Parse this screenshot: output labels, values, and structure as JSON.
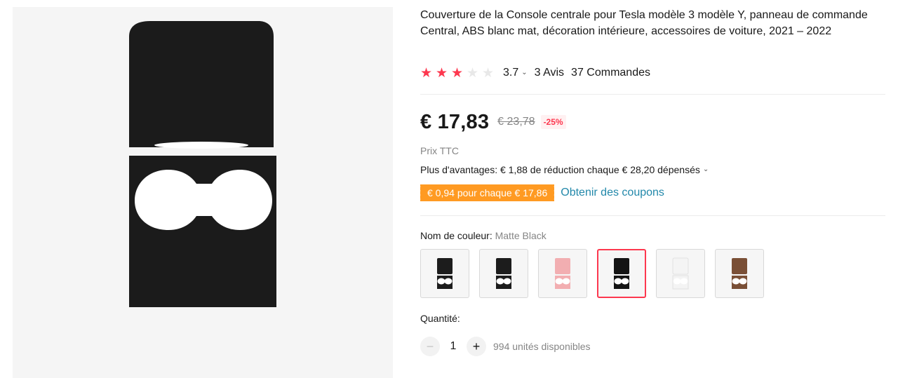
{
  "product": {
    "title": "Couverture de la Console centrale pour Tesla modèle 3 modèle Y, panneau de commande Central, ABS blanc mat, décoration intérieure, accessoires de voiture, 2021 – 2022",
    "image_alt": "Matte Black console cover"
  },
  "rating": {
    "value": "3.7",
    "stars": 3.7,
    "star_count": 5,
    "reviews": "3 Avis",
    "orders": "37 Commandes",
    "star_color": "#fd384f"
  },
  "pricing": {
    "price": "€ 17,83",
    "original_price": "€ 23,78",
    "discount": "-25%",
    "tax_note": "Prix TTC",
    "perks": "Plus d'avantages: € 1,88 de réduction chaque € 28,20 dépensés",
    "coupon": "€ 0,94 pour chaque € 17,86",
    "coupon_link": "Obtenir des coupons",
    "coupon_color": "#ff9a22"
  },
  "color": {
    "label": "Nom de couleur:",
    "selected": "Matte Black",
    "selected_border": "#fd384f",
    "swatches": [
      {
        "name": "swatch-black-1",
        "fill": "#1c1c1c",
        "selected": false
      },
      {
        "name": "swatch-black-2",
        "fill": "#1c1c1c",
        "selected": false
      },
      {
        "name": "swatch-pink",
        "fill": "#f2aeb1",
        "selected": false
      },
      {
        "name": "swatch-matte-black",
        "fill": "#141414",
        "selected": true
      },
      {
        "name": "swatch-white",
        "fill": "#f4f4f4",
        "selected": false
      },
      {
        "name": "swatch-brown",
        "fill": "#7a4f36",
        "selected": false
      }
    ]
  },
  "quantity": {
    "label": "Quantité:",
    "value": "1",
    "minus": "−",
    "plus": "+",
    "available": "994 unités disponibles"
  }
}
